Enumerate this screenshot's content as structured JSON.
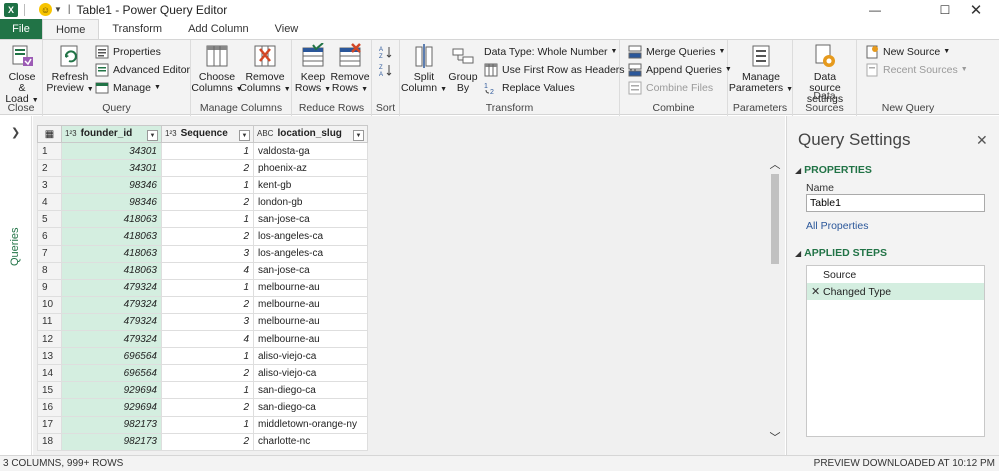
{
  "window": {
    "title": "Table1 - Power Query Editor"
  },
  "tabs": [
    "File",
    "Home",
    "Transform",
    "Add Column",
    "View"
  ],
  "ribbon": {
    "close": {
      "btn": "Close &",
      "btn2": "Load",
      "label": "Close"
    },
    "query": {
      "refresh": "Refresh",
      "refresh2": "Preview",
      "properties": "Properties",
      "advanced": "Advanced Editor",
      "manage": "Manage",
      "label": "Query"
    },
    "manage_columns": {
      "choose": "Choose",
      "choose2": "Columns",
      "remove": "Remove",
      "remove2": "Columns",
      "label": "Manage Columns"
    },
    "reduce_rows": {
      "keep": "Keep",
      "keep2": "Rows",
      "remove": "Remove",
      "remove2": "Rows",
      "label": "Reduce Rows"
    },
    "sort": {
      "label": "Sort"
    },
    "transform": {
      "split": "Split",
      "split2": "Column",
      "group": "Group",
      "group2": "By",
      "datatype": "Data Type: Whole Number",
      "first_row": "Use First Row as Headers",
      "replace": "Replace Values",
      "label": "Transform"
    },
    "combine": {
      "merge": "Merge Queries",
      "append": "Append Queries",
      "combine_files": "Combine Files",
      "label": "Combine"
    },
    "parameters": {
      "manage": "Manage",
      "manage2": "Parameters",
      "label": "Parameters"
    },
    "data_sources": {
      "settings": "Data source",
      "settings2": "settings",
      "label": "Data Sources"
    },
    "new_query": {
      "new_source": "New Source",
      "recent": "Recent Sources",
      "label": "New Query"
    }
  },
  "queries_pane": {
    "label": "Queries"
  },
  "grid": {
    "columns": [
      {
        "type": "1²3",
        "name": "founder_id"
      },
      {
        "type": "1²3",
        "name": "Sequence"
      },
      {
        "type": "ABC",
        "name": "location_slug"
      }
    ],
    "rows": [
      [
        "1",
        "34301",
        "1",
        "valdosta-ga"
      ],
      [
        "2",
        "34301",
        "2",
        "phoenix-az"
      ],
      [
        "3",
        "98346",
        "1",
        "kent-gb"
      ],
      [
        "4",
        "98346",
        "2",
        "london-gb"
      ],
      [
        "5",
        "418063",
        "1",
        "san-jose-ca"
      ],
      [
        "6",
        "418063",
        "2",
        "los-angeles-ca"
      ],
      [
        "7",
        "418063",
        "3",
        "los-angeles-ca"
      ],
      [
        "8",
        "418063",
        "4",
        "san-jose-ca"
      ],
      [
        "9",
        "479324",
        "1",
        "melbourne-au"
      ],
      [
        "10",
        "479324",
        "2",
        "melbourne-au"
      ],
      [
        "11",
        "479324",
        "3",
        "melbourne-au"
      ],
      [
        "12",
        "479324",
        "4",
        "melbourne-au"
      ],
      [
        "13",
        "696564",
        "1",
        "aliso-viejo-ca"
      ],
      [
        "14",
        "696564",
        "2",
        "aliso-viejo-ca"
      ],
      [
        "15",
        "929694",
        "1",
        "san-diego-ca"
      ],
      [
        "16",
        "929694",
        "2",
        "san-diego-ca"
      ],
      [
        "17",
        "982173",
        "1",
        "middletown-orange-ny"
      ],
      [
        "18",
        "982173",
        "2",
        "charlotte-nc"
      ]
    ]
  },
  "settings": {
    "title": "Query Settings",
    "properties_head": "PROPERTIES",
    "name_label": "Name",
    "name_value": "Table1",
    "all_properties": "All Properties",
    "steps_head": "APPLIED STEPS",
    "steps": [
      "Source",
      "Changed Type"
    ]
  },
  "status": {
    "left": "3 COLUMNS, 999+ ROWS",
    "right": "PREVIEW DOWNLOADED AT 10:12 PM"
  },
  "colors": {
    "accent": "#217346",
    "selected": "#d4eee0"
  }
}
